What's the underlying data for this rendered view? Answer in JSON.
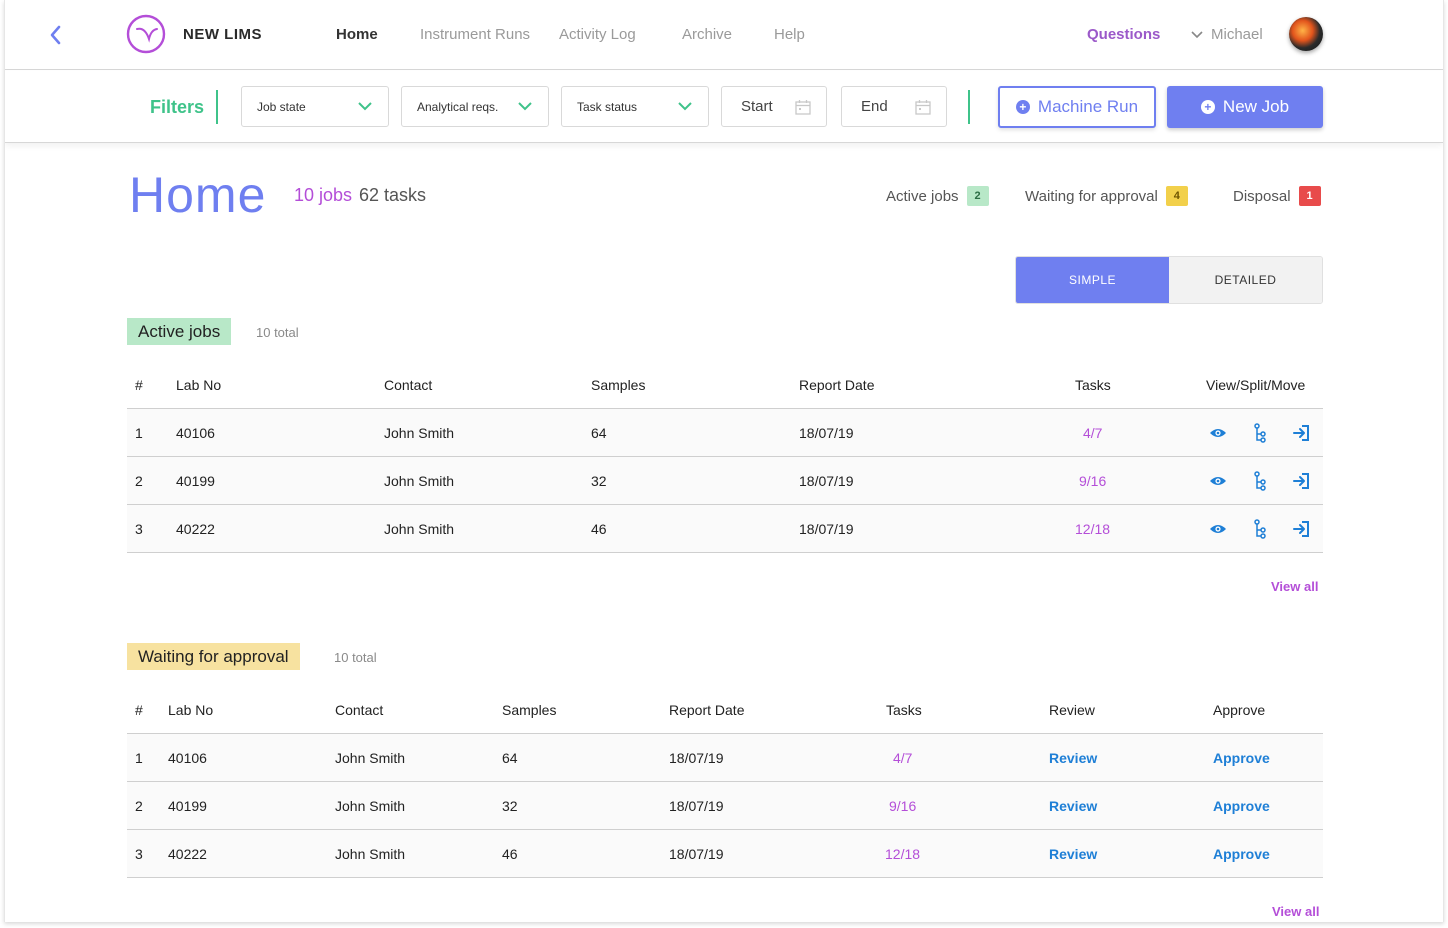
{
  "app": {
    "brand": "NEW LIMS"
  },
  "nav": {
    "items": [
      {
        "label": "Home",
        "active": true
      },
      {
        "label": "Instrument Runs",
        "active": false
      },
      {
        "label": "Activity Log",
        "active": false
      },
      {
        "label": "Archive",
        "active": false
      },
      {
        "label": "Help",
        "active": false
      }
    ],
    "questions": "Questions",
    "user": "Michael"
  },
  "filters": {
    "label": "Filters",
    "job_state": "Job state",
    "analytical_reqs": "Analytical reqs.",
    "task_status": "Task status",
    "start": "Start",
    "end": "End",
    "machine_run": "Machine Run",
    "new_job": "New Job"
  },
  "header": {
    "title": "Home",
    "jobs": "10 jobs",
    "tasks": "62 tasks",
    "stats": {
      "active_label": "Active jobs",
      "active_count": "2",
      "waiting_label": "Waiting for approval",
      "waiting_count": "4",
      "disposal_label": "Disposal",
      "disposal_count": "1"
    }
  },
  "view_toggle": {
    "simple": "SIMPLE",
    "detailed": "DETAILED",
    "selected": "simple"
  },
  "active_jobs": {
    "title": "Active jobs",
    "total": "10 total",
    "columns": [
      "#",
      "Lab No",
      "Contact",
      "Samples",
      "Report Date",
      "Tasks",
      "View/Split/Move"
    ],
    "rows": [
      {
        "n": "1",
        "lab": "40106",
        "contact": "John Smith",
        "samples": "64",
        "date": "18/07/19",
        "tasks": "4/7"
      },
      {
        "n": "2",
        "lab": "40199",
        "contact": "John Smith",
        "samples": "32",
        "date": "18/07/19",
        "tasks": "9/16"
      },
      {
        "n": "3",
        "lab": "40222",
        "contact": "John Smith",
        "samples": "46",
        "date": "18/07/19",
        "tasks": "12/18"
      }
    ],
    "view_all": "View all"
  },
  "waiting": {
    "title": "Waiting for approval",
    "total": "10 total",
    "columns": [
      "#",
      "Lab No",
      "Contact",
      "Samples",
      "Report Date",
      "Tasks",
      "Review",
      "Approve"
    ],
    "rows": [
      {
        "n": "1",
        "lab": "40106",
        "contact": "John Smith",
        "samples": "64",
        "date": "18/07/19",
        "tasks": "4/7",
        "review": "Review",
        "approve": "Approve"
      },
      {
        "n": "2",
        "lab": "40199",
        "contact": "John Smith",
        "samples": "32",
        "date": "18/07/19",
        "tasks": "9/16",
        "review": "Review",
        "approve": "Approve"
      },
      {
        "n": "3",
        "lab": "40222",
        "contact": "John Smith",
        "samples": "46",
        "date": "18/07/19",
        "tasks": "12/18",
        "review": "Review",
        "approve": "Approve"
      }
    ],
    "view_all": "View all"
  },
  "colors": {
    "accent": "#6f7ff0",
    "purple": "#b44ed8",
    "green": "#3fc38a",
    "link_blue": "#1e7fd6"
  },
  "icons": [
    "chevron-left-icon",
    "logo-icon",
    "chevron-down-icon",
    "calendar-icon",
    "plus-circle-icon",
    "eye-icon",
    "split-icon",
    "move-icon"
  ]
}
